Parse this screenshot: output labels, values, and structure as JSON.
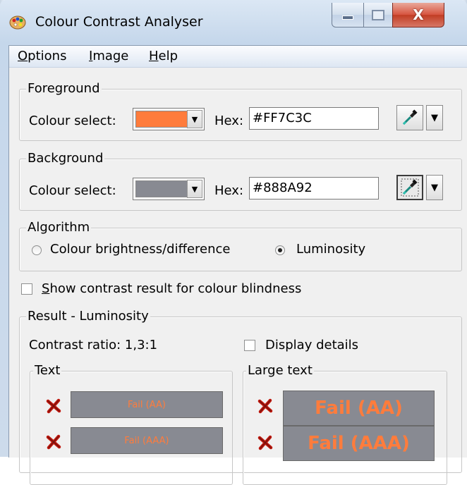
{
  "window": {
    "title": "Colour Contrast Analyser",
    "close_glyph": "X"
  },
  "menu": [
    {
      "label": "Options",
      "accel": "O",
      "rest": "ptions"
    },
    {
      "label": "Image",
      "accel": "I",
      "rest": "mage"
    },
    {
      "label": "Help",
      "accel": "H",
      "rest": "elp"
    }
  ],
  "foreground": {
    "group_label": "Foreground",
    "colour_select_label": "Colour select:",
    "hex_label": "Hex:",
    "hex_value": "#FF7C3C",
    "swatch_color": "#FF7C3C"
  },
  "background": {
    "group_label": "Background",
    "colour_select_label": "Colour select:",
    "hex_label": "Hex:",
    "hex_value": "#888A92",
    "swatch_color": "#888A92"
  },
  "algorithm": {
    "group_label": "Algorithm",
    "options": [
      {
        "label": "Colour brightness/difference",
        "selected": false
      },
      {
        "label": "Luminosity",
        "selected": true
      }
    ]
  },
  "colour_blindness": {
    "label_accel": "S",
    "label_rest": "how contrast result for colour blindness",
    "checked": false
  },
  "result": {
    "group_label": "Result - Luminosity",
    "contrast_ratio": "Contrast ratio: 1,3:1",
    "display_details_label": "Display details",
    "display_details_checked": false,
    "text_group_label": "Text",
    "large_text_group_label": "Large text",
    "text_results": [
      "Fail (AA)",
      "Fail (AAA)"
    ],
    "large_text_results": [
      "Fail (AA)",
      "Fail (AAA)"
    ],
    "fail_icon": "red-x-icon"
  },
  "colors": {
    "result_bg": "#888A92",
    "result_fg": "#FF7C3C",
    "fail_red": "#C0160C"
  }
}
